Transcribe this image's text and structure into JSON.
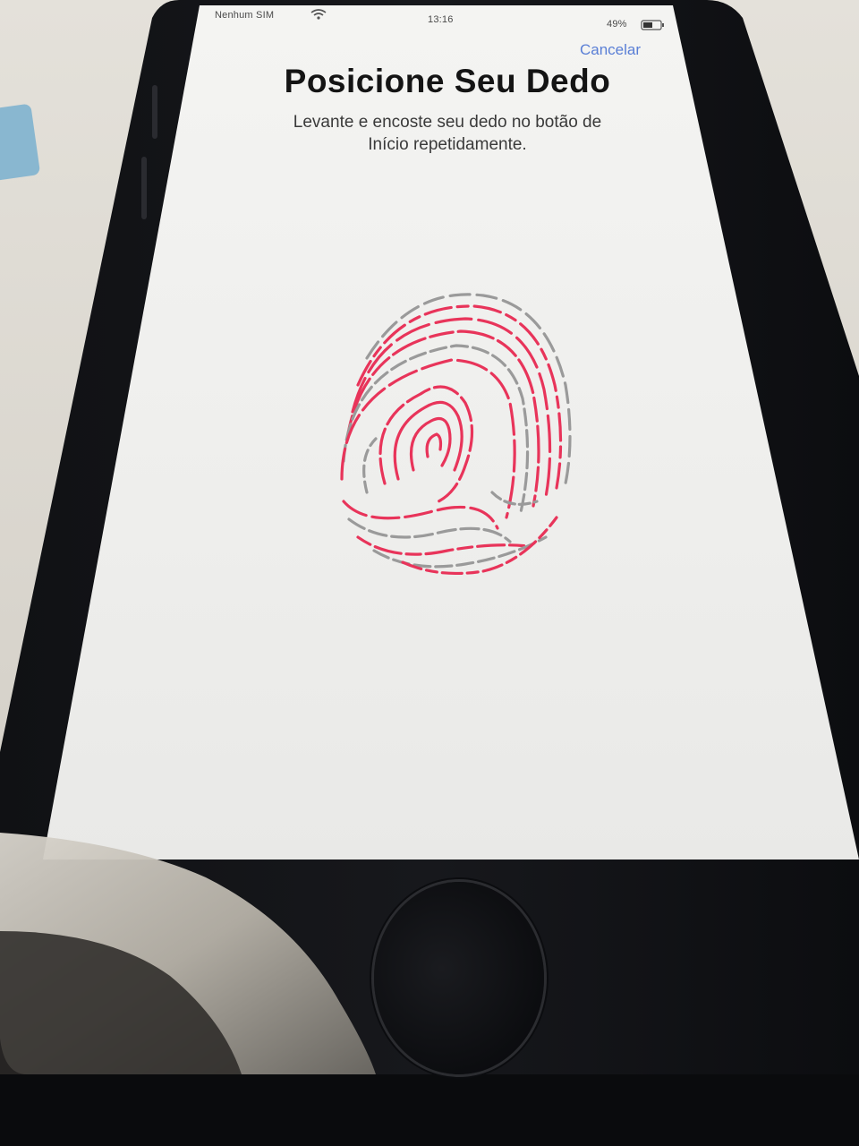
{
  "status_bar": {
    "carrier": "Nenhum SIM",
    "time": "13:16",
    "battery": "49%",
    "wifi_icon": "wifi-icon",
    "battery_icon": "battery-icon"
  },
  "nav": {
    "cancel_label": "Cancelar"
  },
  "content": {
    "title": "Posicione Seu Dedo",
    "subtitle_line1": "Levante e encoste seu dedo no botão de",
    "subtitle_line2": "Início repetidamente."
  },
  "icons": {
    "fingerprint": "fingerprint-icon",
    "home_button": "home-button-icon"
  },
  "colors": {
    "fingerprint_active": "#e8345a",
    "fingerprint_inactive": "#9a9a9a",
    "link": "#5a7fd6",
    "screen_bg": "#f0f0ee"
  }
}
